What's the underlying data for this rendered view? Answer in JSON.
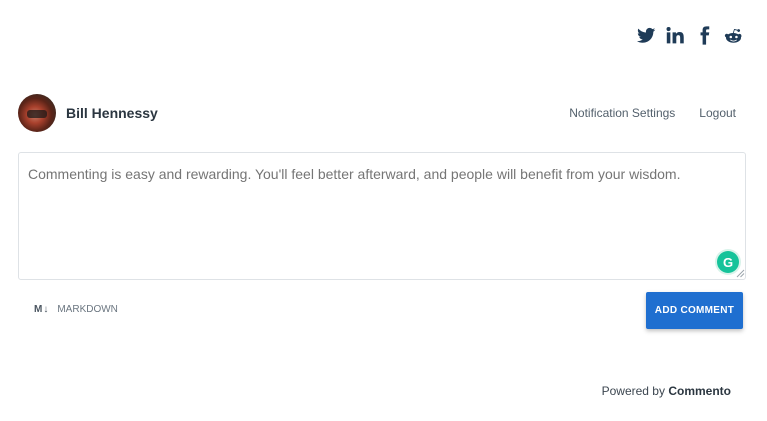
{
  "share": {
    "icons": [
      "twitter-icon",
      "linkedin-icon",
      "facebook-icon",
      "reddit-icon"
    ]
  },
  "user": {
    "name": "Bill Hennessy",
    "notification_settings": "Notification Settings",
    "logout": "Logout"
  },
  "editor": {
    "placeholder": "Commenting is easy and rewarding. You'll feel better afterward, and people will benefit from your wisdom.",
    "value": "",
    "grammarly_badge": "G"
  },
  "footer": {
    "markdown_mark": "M↓",
    "markdown_label": "MARKDOWN",
    "add_comment": "ADD COMMENT",
    "powered_by": "Powered by",
    "brand": "Commento"
  },
  "colors": {
    "accent": "#1f6fd0",
    "icon": "#1f3b57",
    "grammarly": "#15c39a"
  }
}
